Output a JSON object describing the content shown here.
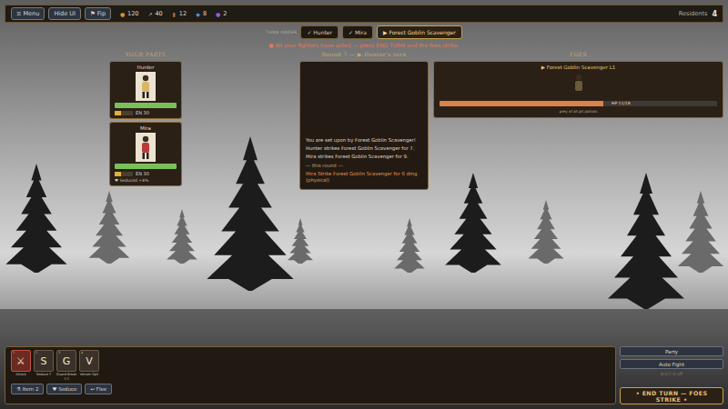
{
  "top_bar": {
    "buttons": [
      {
        "icon": "≡",
        "label": "Menu"
      },
      {
        "icon": "",
        "label": "Hide UI"
      },
      {
        "icon": "⚑",
        "label": "Fip"
      }
    ],
    "resources": [
      {
        "icon": "●",
        "value": "120",
        "color": "#e0902e"
      },
      {
        "icon": "↗",
        "value": "40",
        "color": "#d8cfb8"
      },
      {
        "icon": "▮",
        "value": "12",
        "color": "#b0703a"
      },
      {
        "icon": "◆",
        "value": "8",
        "color": "#5a8fe0"
      },
      {
        "icon": "●",
        "value": "2",
        "color": "#9a5ad8"
      }
    ],
    "residents": {
      "label": "Residents",
      "value": "4"
    }
  },
  "turn_order": {
    "label": "TURN ORDER",
    "entries": [
      {
        "label": "✓ Hunter",
        "selected": false
      },
      {
        "label": "✓ Mira",
        "selected": false
      },
      {
        "label": "▶ Forest Goblin Scavenger",
        "selected": true
      }
    ],
    "notice": "● All your fighters have acted — press END TURN and the foes strike."
  },
  "party": {
    "title": "YOUR PARTY",
    "members": [
      {
        "name": "Hunter",
        "hp_level": 1,
        "en_level": 0.35,
        "en_text": "EN 30",
        "statuses": [],
        "color": "#d8b868"
      },
      {
        "name": "Mira",
        "hp_level": 1,
        "en_level": 0.35,
        "en_text": "EN 30",
        "statuses": [
          "♥ Seduced +4%"
        ],
        "color": "#b83a3a"
      }
    ]
  },
  "round": "Round 7 — ▶ Hunter's turn",
  "log": [
    {
      "text": "You are set upon by Forest Goblin Scavenger!",
      "kind": "text"
    },
    {
      "text": "Hunter strikes Forest Goblin Scavenger for 7.",
      "kind": "text"
    },
    {
      "text": "Mira strikes Forest Goblin Scavenger for 9.",
      "kind": "text"
    },
    {
      "text": "— this round —",
      "kind": "divider"
    },
    {
      "text": "Mira Strike Forest Goblin Scavenger  for 6 dmg (physical)",
      "kind": "highlight"
    }
  ],
  "foes": {
    "title": "FOES",
    "enemies": [
      {
        "name": "▶ Forest Goblin Scavenger L1",
        "hp_level": 0.59,
        "hp_text": "HP 11/18",
        "note": "prey of all pit patrols"
      }
    ]
  },
  "actions": [
    {
      "hotkey": "1",
      "key": "⚔",
      "label": "Attack",
      "cost": "",
      "selected": true
    },
    {
      "hotkey": "2",
      "key": "S",
      "label": "Seduce T",
      "cost": "",
      "selected": false
    },
    {
      "hotkey": "3",
      "key": "G",
      "label": "Guard Break",
      "cost": "3.3",
      "selected": false
    },
    {
      "hotkey": "4",
      "key": "V",
      "label": "Venom Spit",
      "cost": "",
      "selected": false
    }
  ],
  "commands": [
    {
      "icon": "⚗",
      "label": "Item 2"
    },
    {
      "icon": "♥",
      "label": "Seduce"
    },
    {
      "icon": "↩",
      "label": "Flee"
    }
  ],
  "side": {
    "buttons": [
      "Party",
      "Auto Fight"
    ],
    "note": "A·U·T·O off",
    "end_turn": "• END TURN — FOES STRIKE •"
  }
}
